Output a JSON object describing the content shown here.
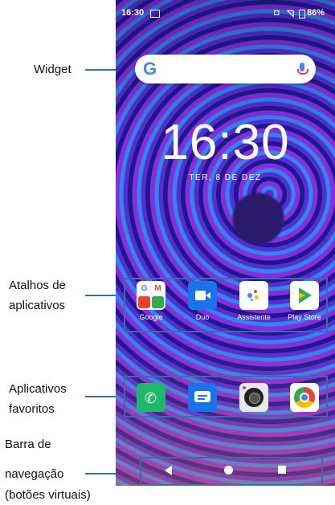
{
  "annotations": {
    "widget": "Widget",
    "shortcuts": "Atalhos de",
    "shortcuts2": "aplicativos",
    "favorites": "Aplicativos",
    "favorites2": "favoritos",
    "navbar1": "Barra de",
    "navbar2": "navegação",
    "navbar3": "(botões virtuais)"
  },
  "status_bar": {
    "time": "16:30",
    "battery": "86%"
  },
  "clock": {
    "time": "16:30",
    "date": "TER, 8 DE DEZ"
  },
  "shortcut_apps": [
    {
      "label": "Google",
      "icon": "google-folder-icon"
    },
    {
      "label": "Duo",
      "icon": "duo-camera-icon"
    },
    {
      "label": "Assistente",
      "icon": "assistant-icon"
    },
    {
      "label": "Play Store",
      "icon": "play-store-icon"
    }
  ],
  "favorite_apps": [
    {
      "icon": "phone-icon"
    },
    {
      "icon": "messages-icon"
    },
    {
      "icon": "camera-icon"
    },
    {
      "icon": "chrome-icon"
    }
  ],
  "colors": {
    "annotation_line": "#3a6bb0",
    "google_blue": "#4285f4"
  }
}
